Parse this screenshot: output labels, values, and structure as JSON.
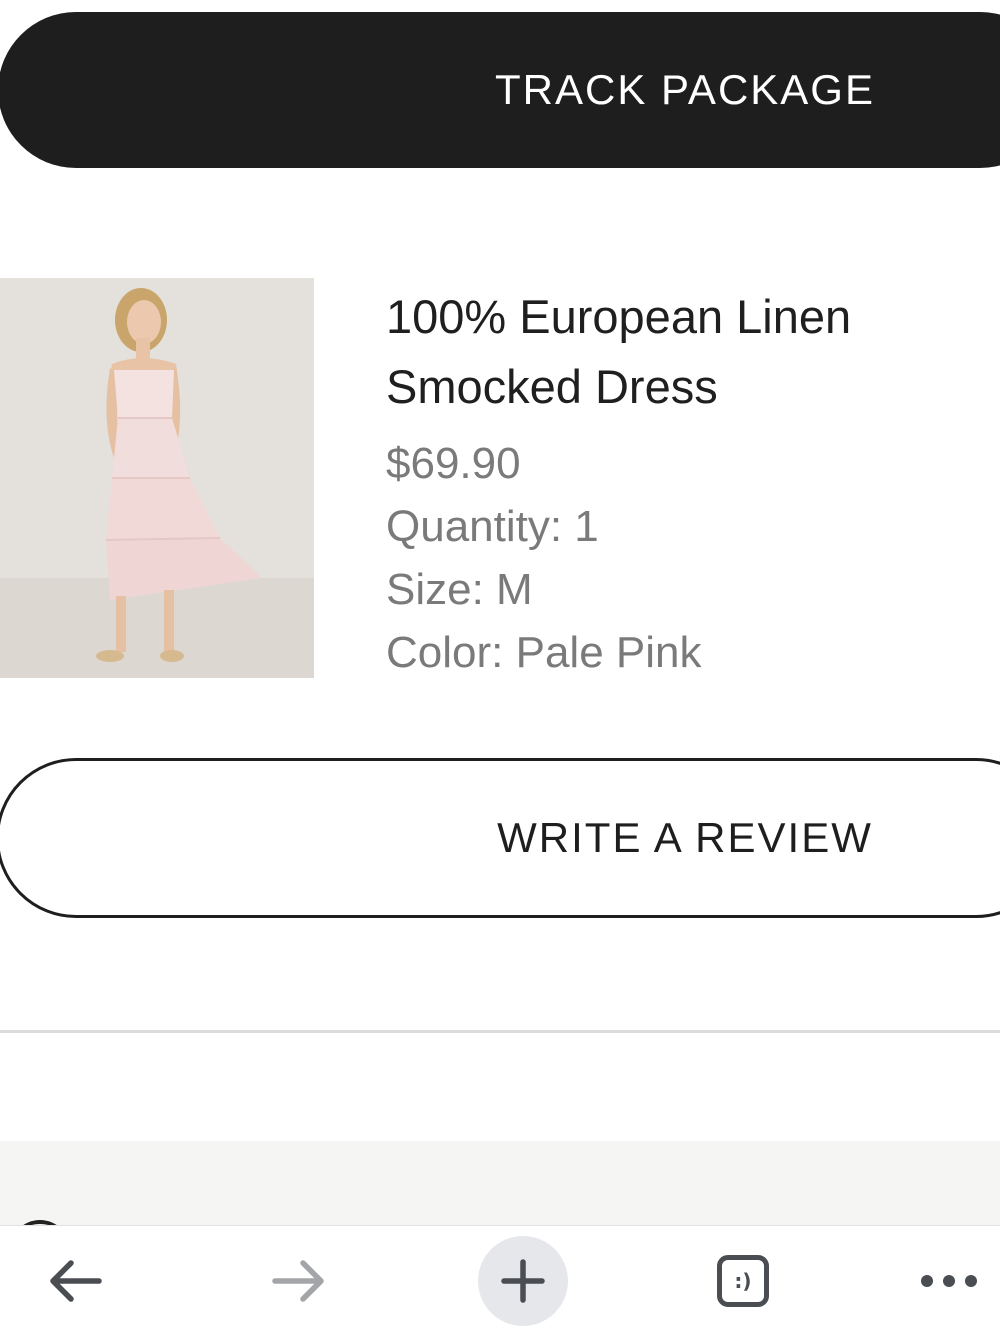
{
  "actions": {
    "track_label": "TRACK PACKAGE",
    "review_label": "WRITE A REVIEW"
  },
  "product": {
    "title": "100% European Linen Smocked Dress",
    "price": "$69.90",
    "quantity": "Quantity: 1",
    "size": "Size: M",
    "color": "Color: Pale Pink"
  },
  "toolbar": {
    "icons": [
      "arrow-left-icon",
      "arrow-right-icon",
      "plus-icon",
      "tabs-icon",
      "more-icon"
    ],
    "tabs_glyph": ":)"
  },
  "colors": {
    "primary": "#1e1e1e",
    "muted_text": "#7a7a7a",
    "toolbar_icon": "#4a4d52"
  }
}
